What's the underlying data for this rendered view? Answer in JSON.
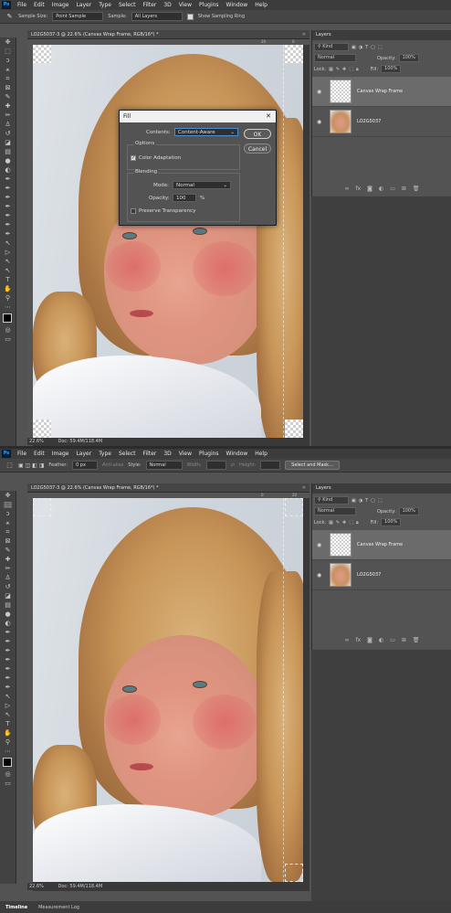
{
  "menu": [
    "File",
    "Edit",
    "Image",
    "Layer",
    "Type",
    "Select",
    "Filter",
    "3D",
    "View",
    "Plugins",
    "Window",
    "Help"
  ],
  "app_logo": "Ps",
  "top": {
    "options": {
      "sample_size_label": "Sample Size:",
      "sample_size_value": "Point Sample",
      "sample_label": "Sample:",
      "sample_value": "All Layers",
      "show_sampling_ring": "Show Sampling Ring"
    },
    "tab_title": "LO2G5037-3 @ 22.6% (Canvas Wrap Frame, RGB/16*) *",
    "ruler_ticks": [
      "20",
      "0"
    ],
    "fill_dialog": {
      "title": "Fill",
      "contents_label": "Contents:",
      "contents_value": "Content-Aware",
      "options_label": "Options",
      "color_adaptation": "Color Adaptation",
      "blending_label": "Blending",
      "mode_label": "Mode:",
      "mode_value": "Normal",
      "opacity_label": "Opacity:",
      "opacity_value": "100",
      "opacity_unit": "%",
      "preserve_transparency": "Preserve Transparency",
      "ok": "OK",
      "cancel": "Cancel"
    },
    "layers_panel": {
      "title": "Layers",
      "kind": "Kind",
      "blend_mode": "Normal",
      "opacity_label": "Opacity:",
      "opacity_value": "100%",
      "lock_label": "Lock:",
      "fill_label": "Fill:",
      "fill_value": "100%",
      "layers": [
        {
          "name": "Canvas Wrap Frame"
        },
        {
          "name": "LO2G5037"
        }
      ]
    }
  },
  "bottom": {
    "options": {
      "feather_label": "Feather:",
      "feather_value": "0 px",
      "anti_alias": "Anti-alias",
      "style_label": "Style:",
      "style_value": "Normal",
      "width_label": "Width:",
      "height_label": "Height:",
      "select_and_mask": "Select and Mask..."
    },
    "tab_title": "LO2G5037-3 @ 22.6% (Canvas Wrap Frame, RGB/16*) *",
    "ruler_ticks": [
      "0",
      "20"
    ],
    "status_zoom": "22.6%",
    "status_doc": "Doc: 59.4M/118.4M",
    "layers_panel": {
      "title": "Layers",
      "kind": "Kind",
      "blend_mode": "Normal",
      "opacity_label": "Opacity:",
      "opacity_value": "100%",
      "lock_label": "Lock:",
      "fill_label": "Fill:",
      "fill_value": "100%",
      "layers": [
        {
          "name": "Canvas Wrap Frame"
        },
        {
          "name": "LO2G5037"
        }
      ]
    },
    "bottom_tabs": [
      "Timeline",
      "Measurement Log"
    ]
  },
  "top_status": {
    "zoom": "22.6%",
    "doc": "Doc: 59.4M/118.4M"
  }
}
